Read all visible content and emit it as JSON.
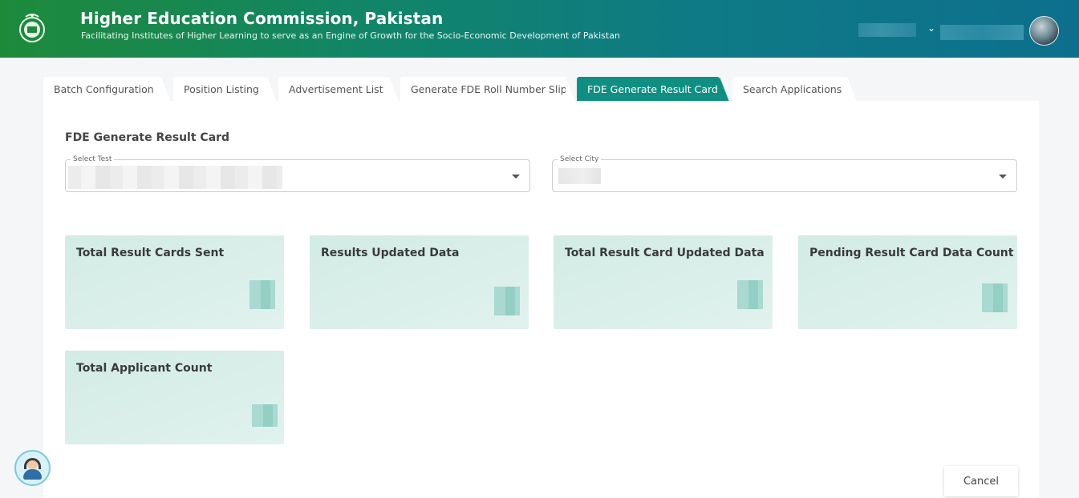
{
  "header": {
    "title": "Higher Education Commission, Pakistan",
    "subtitle": "Facilitating Institutes of Higher Learning to serve as an Engine of Growth for the Socio-Economic Development of Pakistan",
    "icons": {
      "logo": "hec-crest-icon",
      "dropdown": "chevron-down-icon",
      "avatar": "user-avatar"
    },
    "colors": {
      "gradient_start": "#1d8a3a",
      "gradient_end": "#0d6f8d"
    }
  },
  "tabs": [
    {
      "label": "Batch Configuration",
      "active": false
    },
    {
      "label": "Position Listing",
      "active": false
    },
    {
      "label": "Advertisement List",
      "active": false
    },
    {
      "label": "Generate FDE Roll Number Slip",
      "active": false
    },
    {
      "label": "FDE Generate Result Card",
      "active": true
    },
    {
      "label": "Search Applications",
      "active": false
    }
  ],
  "main": {
    "section_title": "FDE Generate Result Card",
    "filters": {
      "test": {
        "label": "Select Test"
      },
      "city": {
        "label": "Select City"
      }
    },
    "cards": [
      {
        "title": "Total Result Cards Sent"
      },
      {
        "title": "Results Updated Data"
      },
      {
        "title": "Total Result Card Updated Data"
      },
      {
        "title": "Pending Result Card Data Count"
      },
      {
        "title": "Total Applicant Count"
      }
    ],
    "cancel_label": "Cancel"
  },
  "support": {
    "icon": "customer-support-icon"
  },
  "colors": {
    "accent": "#0f8f82",
    "card_bg": "#d6eee8"
  }
}
